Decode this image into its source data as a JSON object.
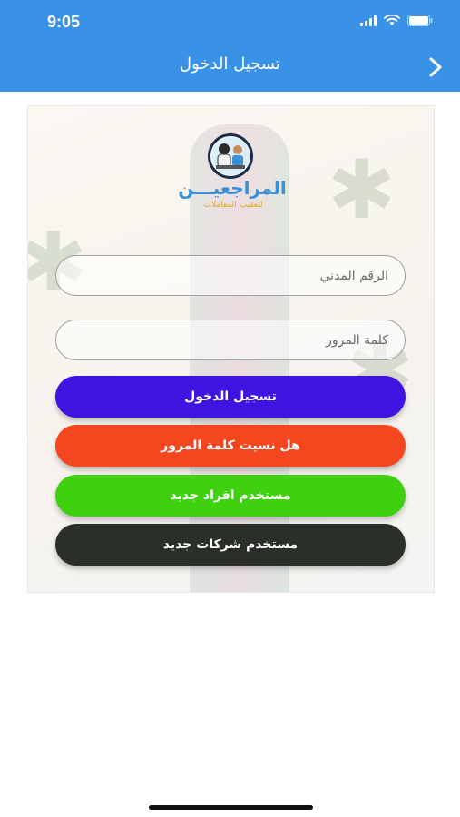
{
  "status_bar": {
    "time": "9:05"
  },
  "header": {
    "title": "تسجيل الدخول"
  },
  "logo": {
    "title": "المراجعيـــن",
    "subtitle": "لتعقيب المعاملات"
  },
  "form": {
    "civil_id_placeholder": "الرقم المدني",
    "password_placeholder": "كلمة المرور"
  },
  "buttons": {
    "login": "تسجيل الدخول",
    "forgot_password": "هل نسيت كلمة المرور",
    "new_individual": "مستخدم افراد جديد",
    "new_company": "مستخدم شركات جديد"
  },
  "colors": {
    "header": "#3a92e6",
    "login": "#3f13e0",
    "forgot": "#f4461f",
    "individual": "#3fd10f",
    "company": "#2b2f2a"
  }
}
